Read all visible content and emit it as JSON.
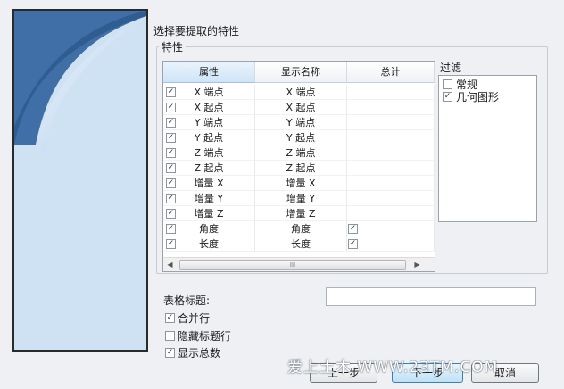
{
  "dialog": {
    "instruction": "选择要提取的特性"
  },
  "properties_group": {
    "title": "特性",
    "columns": [
      "属性",
      "显示名称",
      "总计"
    ],
    "rows": [
      {
        "property": "X 端点",
        "display": "X 端点",
        "checked": true,
        "total": false
      },
      {
        "property": "X 起点",
        "display": "X 起点",
        "checked": true,
        "total": false
      },
      {
        "property": "Y 端点",
        "display": "Y 端点",
        "checked": true,
        "total": false
      },
      {
        "property": "Y 起点",
        "display": "Y 起点",
        "checked": true,
        "total": false
      },
      {
        "property": "Z 端点",
        "display": "Z 端点",
        "checked": true,
        "total": false
      },
      {
        "property": "Z 起点",
        "display": "Z 起点",
        "checked": true,
        "total": false
      },
      {
        "property": "增量 X",
        "display": "增量 X",
        "checked": true,
        "total": false
      },
      {
        "property": "增量 Y",
        "display": "增量 Y",
        "checked": true,
        "total": false
      },
      {
        "property": "增量 Z",
        "display": "增量 Z",
        "checked": true,
        "total": false
      },
      {
        "property": "角度",
        "display": "角度",
        "checked": true,
        "total": true
      },
      {
        "property": "长度",
        "display": "长度",
        "checked": true,
        "total": true
      }
    ],
    "scroll_left_icon": "◀",
    "scroll_right_icon": "▶",
    "scroll_grip": "III"
  },
  "filter": {
    "title": "过滤",
    "items": [
      {
        "label": "常规",
        "checked": false
      },
      {
        "label": "几何图形",
        "checked": true
      }
    ]
  },
  "table_title": {
    "label": "表格标题:",
    "value": ""
  },
  "options": [
    {
      "label": "合并行",
      "checked": true
    },
    {
      "label": "隐藏标题行",
      "checked": false
    },
    {
      "label": "显示总数",
      "checked": true
    }
  ],
  "buttons": {
    "back": "上一步",
    "next": "下一步",
    "cancel": "取消"
  },
  "watermark": "爱上土木 WWW.23TM.COM",
  "check_glyph": "✓",
  "colors": {
    "side_panel_dark": "#3f6fa6",
    "side_panel_light": "#cfe2f4",
    "primary_button": "#bfe0f6"
  }
}
